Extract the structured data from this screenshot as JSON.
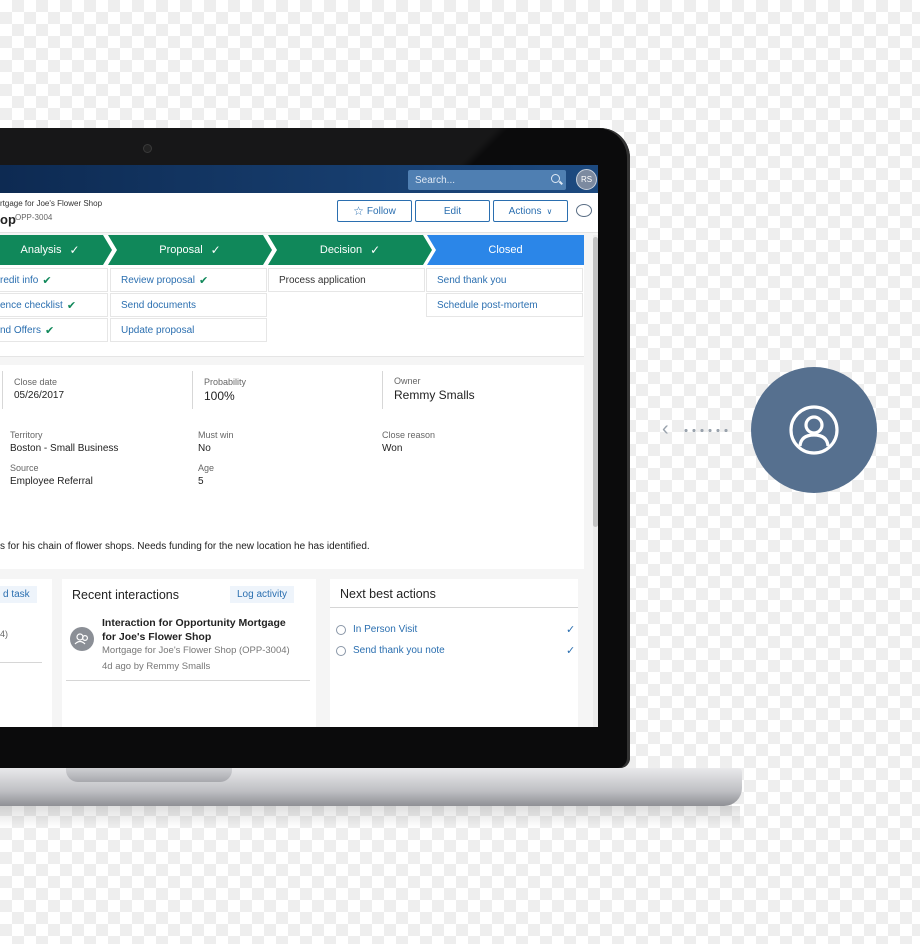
{
  "topbar": {
    "search_placeholder": "Search...",
    "avatar_initials": "RS"
  },
  "header": {
    "breadcrumb": "rtgage for Joe's Flower Shop",
    "title": "op",
    "opp_id": "OPP-3004",
    "buttons": {
      "follow": "Follow",
      "edit": "Edit",
      "actions": "Actions"
    }
  },
  "stages": [
    {
      "label": "Analysis",
      "status": "done"
    },
    {
      "label": "Proposal",
      "status": "done"
    },
    {
      "label": "Decision",
      "status": "done"
    },
    {
      "label": "Closed",
      "status": "active"
    }
  ],
  "tasks": {
    "analysis": [
      "redit info",
      "ence checklist",
      "nd Offers"
    ],
    "proposal": [
      "Review proposal",
      "Send documents",
      "Update proposal"
    ],
    "decision": [
      "Process application"
    ],
    "closed": [
      "Send thank you",
      "Schedule post-mortem"
    ]
  },
  "details": {
    "close_date": {
      "label": "Close date",
      "value": "05/26/2017"
    },
    "probability": {
      "label": "Probability",
      "value": "100%"
    },
    "owner": {
      "label": "Owner",
      "value": "Remmy Smalls"
    },
    "territory": {
      "label": "Territory",
      "value": "Boston - Small Business"
    },
    "must_win": {
      "label": "Must win",
      "value": "No"
    },
    "close_reason": {
      "label": "Close reason",
      "value": "Won"
    },
    "source": {
      "label": "Source",
      "value": "Employee Referral"
    },
    "age": {
      "label": "Age",
      "value": "5"
    },
    "description": "s for his chain of flower shops. Needs funding for the new location he has identified."
  },
  "tasks_card": {
    "add_task": "d task",
    "item_fragment": "4)"
  },
  "interactions_card": {
    "title": "Recent interactions",
    "log_activity": "Log activity",
    "item": {
      "title": "Interaction for Opportunity Mortgage for Joe's Flower Shop",
      "subtitle": "Mortgage for Joe's Flower Shop  (OPP-3004)",
      "meta": "4d ago   by Remmy Smalls"
    }
  },
  "nba_card": {
    "title": "Next best actions",
    "items": [
      "In Person Visit",
      "Send thank you note"
    ]
  },
  "colors": {
    "stage_done": "#10885a",
    "stage_active": "#2b86e8",
    "topbar": "#0d2a52",
    "user_badge": "#56708f"
  },
  "icons": [
    "search-icon",
    "star-icon",
    "chevron-down-icon",
    "chat-icon",
    "check-icon",
    "info-icon",
    "user-icon",
    "arrow-left-icon"
  ]
}
